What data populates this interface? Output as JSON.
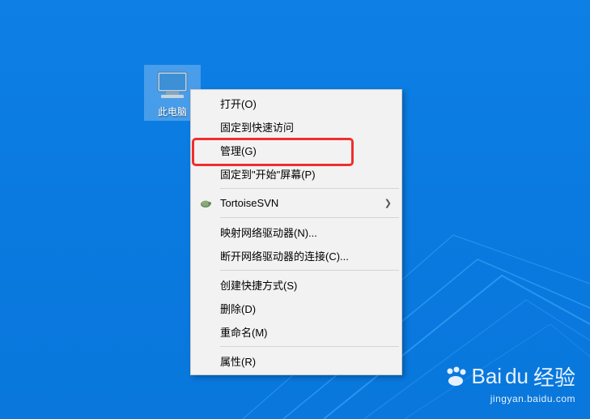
{
  "desktop": {
    "icon_label": "此电脑"
  },
  "menu": {
    "open": "打开(O)",
    "pin_quick": "固定到快速访问",
    "manage": "管理(G)",
    "pin_start": "固定到\"开始\"屏幕(P)",
    "tortoise": "TortoiseSVN",
    "map_drive": "映射网络驱动器(N)...",
    "disconnect_drive": "断开网络驱动器的连接(C)...",
    "create_shortcut": "创建快捷方式(S)",
    "delete": "删除(D)",
    "rename": "重命名(M)",
    "properties": "属性(R)"
  },
  "watermark": {
    "brand_left": "Bai",
    "brand_right": "经验",
    "url": "jingyan.baidu.com"
  }
}
